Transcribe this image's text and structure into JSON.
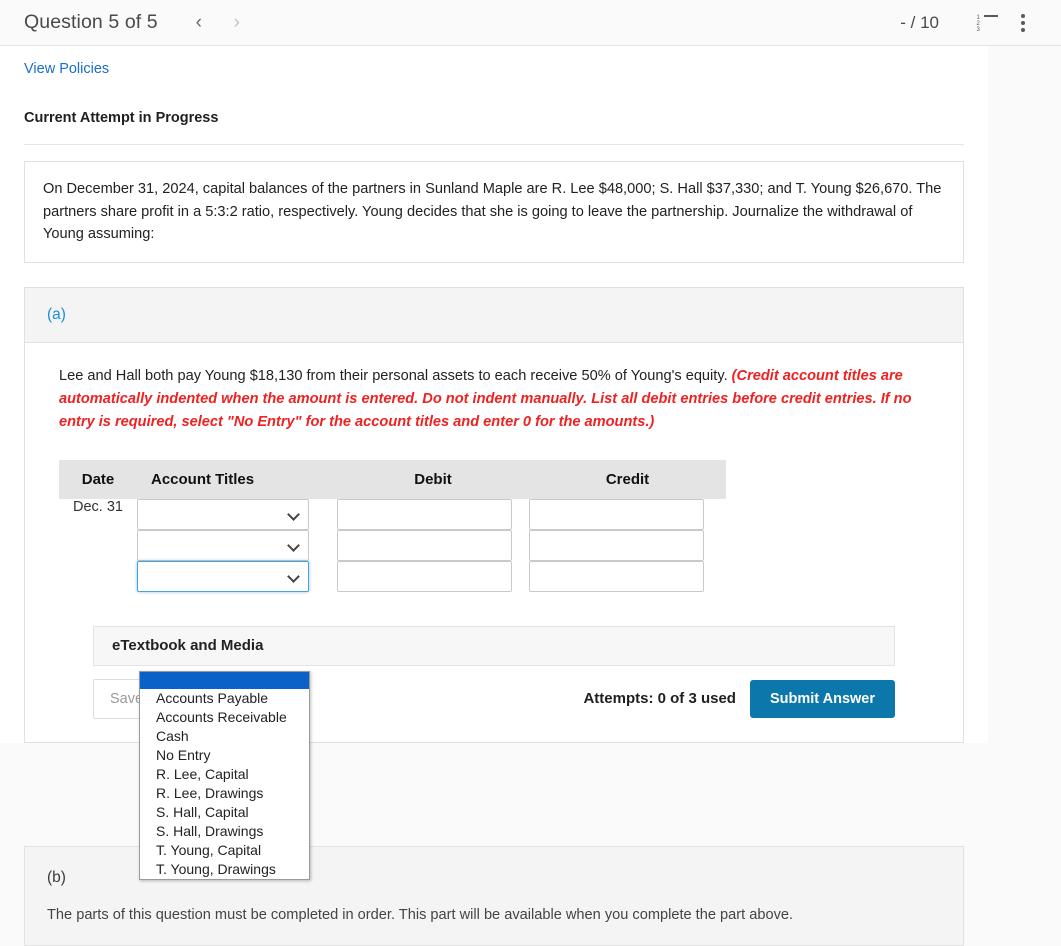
{
  "header": {
    "title": "Question 5 of 5",
    "prev_icon": "chevron-left-icon",
    "prev_label": "‹",
    "next_icon": "chevron-right-icon",
    "next_label": "›",
    "score": "- / 10",
    "list_icon": "numbered-list-icon",
    "menu_icon": "kebab-menu-icon",
    "list_numbers": [
      "1",
      "2",
      "3"
    ]
  },
  "panel": {
    "view_policies": "View Policies",
    "attempt_status": "Current Attempt in Progress",
    "problem_text": "On December 31, 2024, capital balances of the partners in Sunland Maple are R. Lee $48,000; S. Hall $37,330; and T. Young $26,670. The partners share profit in a 5:3:2 ratio, respectively. Young decides that she is going to leave the partnership. Journalize the withdrawal of Young assuming:"
  },
  "part_a": {
    "label": "(a)",
    "instruction_plain": "Lee and Hall both pay Young $18,130 from their personal assets to each receive 50% of Young's equity. ",
    "instruction_red": "(Credit account titles are automatically indented when the amount is entered. Do not indent manually. List all debit entries before credit entries. If no entry is required, select \"No Entry\" for the account titles and enter 0 for the amounts.)",
    "table": {
      "columns": [
        "Date",
        "Account Titles",
        "Debit",
        "Credit"
      ],
      "rows": [
        {
          "date": "Dec. 31",
          "account": "",
          "debit": "",
          "credit": ""
        },
        {
          "date": "",
          "account": "",
          "debit": "",
          "credit": ""
        },
        {
          "date": "",
          "account": "",
          "debit": "",
          "credit": ""
        }
      ]
    },
    "dropdown": {
      "open": true,
      "selected": "",
      "options": [
        "",
        "Accounts Payable",
        "Accounts Receivable",
        "Cash",
        "No Entry",
        "R. Lee, Capital",
        "R. Lee, Drawings",
        "S. Hall, Capital",
        "S. Hall, Drawings",
        "T. Young, Capital",
        "T. Young, Drawings"
      ]
    },
    "etextbook_label": "eTextbook and Media",
    "save_for_later": "Save for Later",
    "attempts": "Attempts: 0 of 3 used",
    "submit": "Submit Answer"
  },
  "part_b": {
    "label": "(b)",
    "message": "The parts of this question must be completed in order. This part will be available when you complete the part above."
  },
  "colors": {
    "link": "#1a6ecc",
    "part_label": "#1a8fd4",
    "warning_red": "#ee2222",
    "submit_button": "#0c77aa",
    "dropdown_highlight": "#0a62c8",
    "table_header": "#e4e4e4"
  }
}
